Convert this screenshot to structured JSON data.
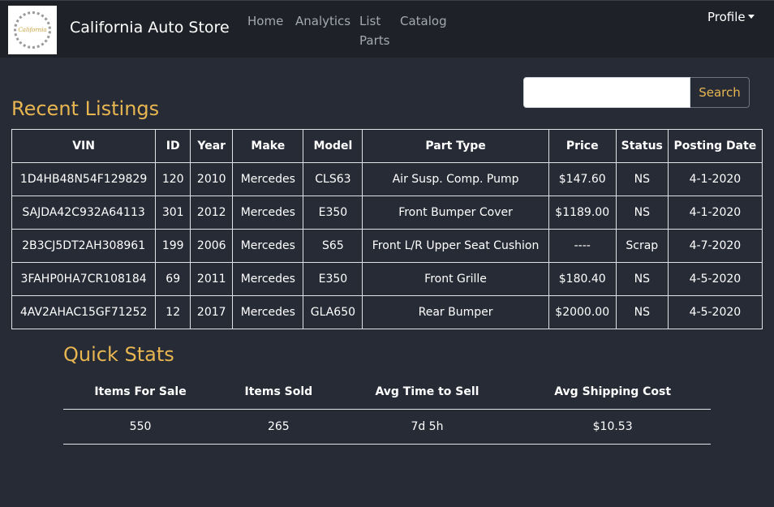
{
  "navbar": {
    "logo_text": "California",
    "brand": "California Auto Store",
    "links": [
      "Home",
      "Analytics",
      "List Parts",
      "Catalog"
    ],
    "profile": "Profile"
  },
  "search": {
    "value": "",
    "placeholder": "",
    "button_label": "Search"
  },
  "recent_listings": {
    "title": "Recent Listings",
    "columns": [
      "VIN",
      "ID",
      "Year",
      "Make",
      "Model",
      "Part Type",
      "Price",
      "Status",
      "Posting Date"
    ],
    "rows": [
      [
        "1D4HB48N54F129829",
        "120",
        "2010",
        "Mercedes",
        "CLS63",
        "Air Susp. Comp. Pump",
        "$147.60",
        "NS",
        "4-1-2020"
      ],
      [
        "SAJDA42C932A64113",
        "301",
        "2012",
        "Mercedes",
        "E350",
        "Front Bumper Cover",
        "$1189.00",
        "NS",
        "4-1-2020"
      ],
      [
        "2B3CJ5DT2AH308961",
        "199",
        "2006",
        "Mercedes",
        "S65",
        "Front L/R Upper Seat Cushion",
        "----",
        "Scrap",
        "4-7-2020"
      ],
      [
        "3FAHP0HA7CR108184",
        "69",
        "2011",
        "Mercedes",
        "E350",
        "Front Grille",
        "$180.40",
        "NS",
        "4-5-2020"
      ],
      [
        "4AV2AHAC15GF71252",
        "12",
        "2017",
        "Mercedes",
        "GLA650",
        "Rear Bumper",
        "$2000.00",
        "NS",
        "4-5-2020"
      ]
    ]
  },
  "quick_stats": {
    "title": "Quick Stats",
    "columns": [
      "Items For Sale",
      "Items Sold",
      "Avg Time to Sell",
      "Avg Shipping Cost"
    ],
    "values": [
      "550",
      "265",
      "7d 5h",
      "$10.53"
    ]
  },
  "colors": {
    "background": "#272b36",
    "navbar": "#1e2127",
    "accent": "#e8b651"
  }
}
